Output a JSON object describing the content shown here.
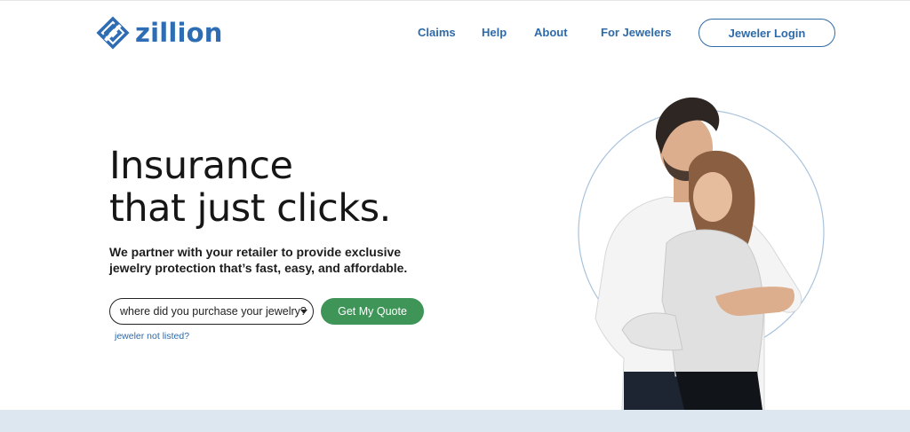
{
  "header": {
    "logo_text": "zillion",
    "nav": {
      "claims": "Claims",
      "help": "Help",
      "about": "About",
      "for_jewelers": "For Jewelers"
    },
    "login_label": "Jeweler Login"
  },
  "hero": {
    "headline_line1": "Insurance",
    "headline_line2": "that just clicks.",
    "subtext_line1": "We partner with your retailer to provide exclusive",
    "subtext_line2": "jewelry protection that’s fast, easy, and affordable.",
    "select_value": "where did you purchase your jewelry?",
    "cta_label": "Get My Quote",
    "not_listed_link": "jeweler not listed?"
  },
  "icons": {
    "logo": "zillion-logo-mark-icon",
    "select": "caret-down-icon"
  },
  "colors": {
    "brand_blue": "#2f6aa8",
    "cta_green": "#3f9558",
    "band": "#dde7f0"
  }
}
